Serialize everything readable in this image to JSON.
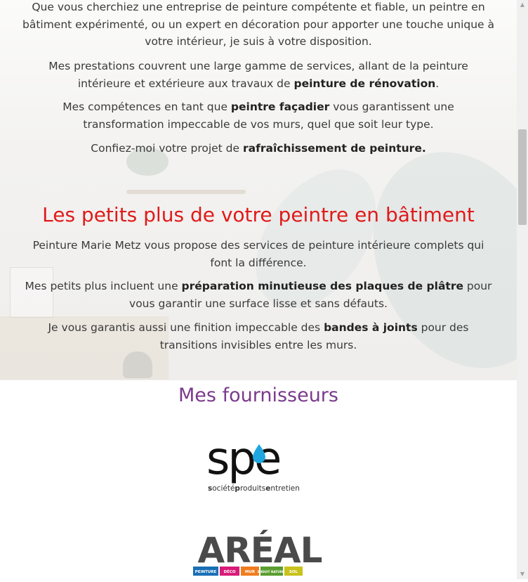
{
  "intro": {
    "p1": "Que vous cherchiez une entreprise de peinture compétente et fiable, un peintre en bâtiment expérimenté, ou un expert en décoration pour apporter une touche unique à votre intérieur, je suis à votre disposition.",
    "p2_pre": "Mes prestations couvrent une large gamme de services, allant de la peinture intérieure et extérieure aux travaux de ",
    "p2_bold": "peinture de rénovation",
    "p2_post": ".",
    "p3_pre": "Mes compétences en tant que ",
    "p3_bold": "peintre façadier",
    "p3_post": " vous garantissent une transformation impeccable de vos murs, quel que soit leur type.",
    "p4_pre": "Confiez-moi votre projet de ",
    "p4_bold": "rafraîchissement de peinture."
  },
  "plus": {
    "title": "Les petits plus de votre peintre en bâtiment",
    "p1": "Peinture Marie Metz vous propose des services de peinture intérieure complets qui font la différence.",
    "p2_pre": "Mes petits plus incluent une ",
    "p2_bold": "préparation minutieuse des plaques de plâtre",
    "p2_post": " pour vous garantir une surface lisse et sans défauts.",
    "p3_pre": "Je vous garantis aussi une finition impeccable des ",
    "p3_bold": "bandes à joints",
    "p3_post": " pour des transitions invisibles entre les murs."
  },
  "suppliers": {
    "title": "Mes fournisseurs",
    "spe": {
      "wordmark": "spe",
      "tagline": [
        "s",
        "ociété",
        "p",
        "roduits",
        "e",
        "ntretien"
      ],
      "drop_color": "#1ea7e1"
    },
    "areal": {
      "wordmark": "ARÉAL",
      "bands": [
        {
          "label": "PEINTURE",
          "color": "#1a6fb5"
        },
        {
          "label": "DÉCO",
          "color": "#d81b7a"
        },
        {
          "label": "MUR",
          "color": "#f07c1e"
        },
        {
          "label": "ENDUIT NATUREL",
          "color": "#5a9e2f"
        },
        {
          "label": "SOL",
          "color": "#c9c21c"
        }
      ]
    }
  },
  "colors": {
    "heading_red": "#e01a1a",
    "heading_purple": "#7b3a8c"
  }
}
